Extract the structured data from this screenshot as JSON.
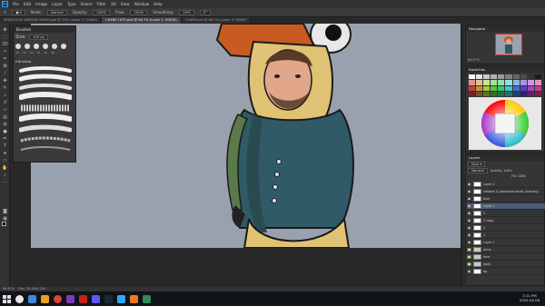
{
  "app": {
    "logo": "Ps"
  },
  "menu": [
    "File",
    "Edit",
    "Image",
    "Layer",
    "Type",
    "Select",
    "Filter",
    "3D",
    "View",
    "Window",
    "Help"
  ],
  "options": {
    "mode_label": "Mode:",
    "mode_value": "Normal",
    "opacity_label": "Opacity:",
    "opacity_value": "100%",
    "flow_label": "Flow:",
    "flow_value": "100%",
    "smoothing_label": "Smoothing:",
    "smoothing_value": "10%",
    "angle_value": "0°"
  },
  "tabs": [
    {
      "label": "SENSE2034 ARMSIZE DAMM.psd @ 50% (Layer 1, RGB/8)",
      "active": false
    },
    {
      "label": "CHARE 1670.psd @ 66.7% (Layer 2, RGB/8)",
      "active": true
    },
    {
      "label": "CHARE.psd @ 66.7% (Layer 4, RGB/8)",
      "active": false
    }
  ],
  "brushes_panel": {
    "title": "Brushes",
    "size_label": "Size:",
    "size_value": "100 px",
    "folder_label": "Brushes",
    "small_sizes": [
      "30",
      "30",
      "30",
      "25",
      "25",
      "36"
    ]
  },
  "right": {
    "navigator_title": "Navigator",
    "navigator_zoom": "66.67%",
    "swatches_title": "Swatches",
    "layers_title": "Layers",
    "blend_mode": "Normal",
    "opacity_label": "Opacity: 100%",
    "fill_label": "Fill: 100%",
    "layers": [
      {
        "name": "Layer 2",
        "type": "layer",
        "selected": false,
        "green": false
      },
      {
        "name": "shadow & grayscale boost (overlay)",
        "type": "layer",
        "selected": false,
        "green": false
      },
      {
        "name": "blue",
        "type": "layer",
        "selected": false,
        "green": false
      },
      {
        "name": "Layer 1",
        "type": "layer",
        "selected": true,
        "green": false
      },
      {
        "name": "2",
        "type": "layer",
        "selected": false,
        "green": false
      },
      {
        "name": "2 copy",
        "type": "layer",
        "selected": false,
        "green": false
      },
      {
        "name": "2",
        "type": "layer",
        "selected": false,
        "green": false
      },
      {
        "name": "1",
        "type": "layer",
        "selected": false,
        "green": false
      },
      {
        "name": "Layer 1",
        "type": "layer",
        "selected": false,
        "green": false
      },
      {
        "name": "arms",
        "type": "folder",
        "selected": false,
        "green": true
      },
      {
        "name": "face",
        "type": "folder",
        "selected": false,
        "green": true
      },
      {
        "name": "body",
        "type": "folder",
        "selected": false,
        "green": true
      },
      {
        "name": "bg",
        "type": "layer",
        "selected": false,
        "green": false
      }
    ]
  },
  "status": {
    "zoom": "66.67%",
    "doc": "Doc: 25.2M/1.23G"
  },
  "clock": {
    "time": "2:11 PM",
    "date": "2022-04-08"
  },
  "colors": {
    "canvas_bg": "#9aa1ae",
    "accent": "#31a8ff",
    "selected_layer": "#4a5d76"
  }
}
